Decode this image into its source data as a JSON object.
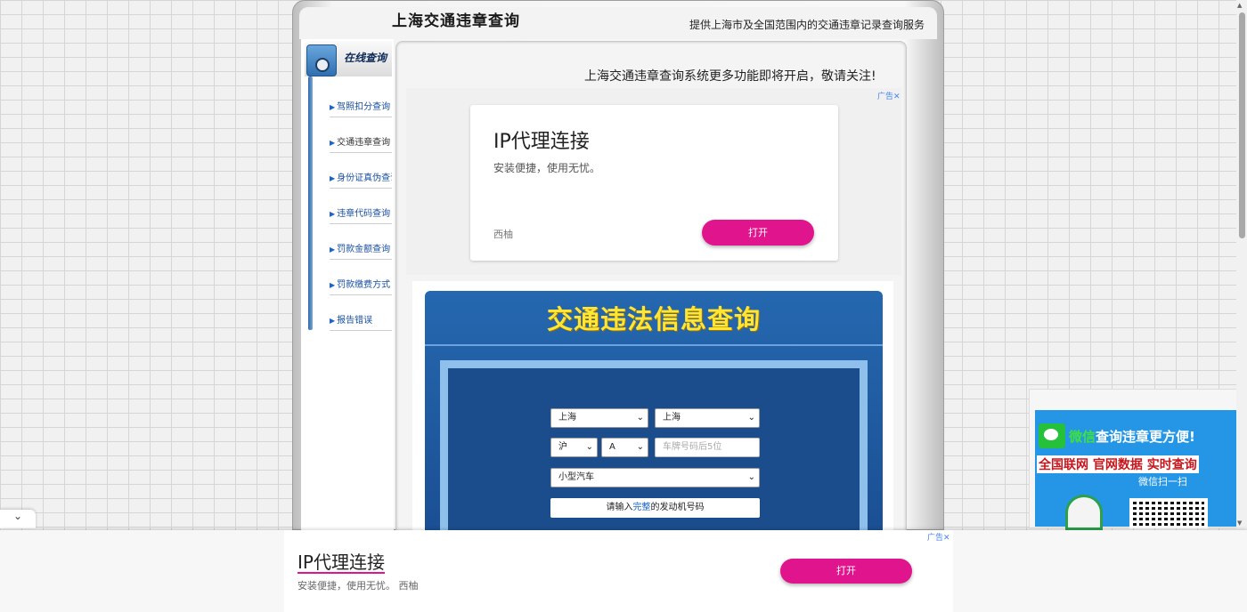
{
  "header": {
    "title": "上海交通违章查询",
    "slogan": "提供上海市及全国范围内的交通违章记录查询服务"
  },
  "menu": {
    "heading": "在线查询",
    "items": [
      {
        "label": "驾照扣分查询"
      },
      {
        "label": "交通违章查询"
      },
      {
        "label": "身份证真伪查询"
      },
      {
        "label": "违章代码查询"
      },
      {
        "label": "罚款金额查询"
      },
      {
        "label": "罚款缴费方式"
      },
      {
        "label": "报告错误"
      }
    ]
  },
  "notice": "上海交通违章查询系统更多功能即将开启，敬请关注!",
  "ad_top": {
    "mark": "广告",
    "close": "✕",
    "title": "IP代理连接",
    "subtitle": "安装便捷，使用无忧。",
    "brand": "西柚",
    "button": "打开"
  },
  "query": {
    "title": "交通违法信息查询",
    "province": "上海",
    "city": "上海",
    "plate_prefix": "沪",
    "plate_letter": "A",
    "plate_placeholder": "车牌号码后5位",
    "vehicle_type": "小型汽车",
    "engine_before": "请输入",
    "engine_highlight": "完整",
    "engine_after": "的发动机号码"
  },
  "wechat_promo": {
    "line1_green": "微信",
    "line1_white": "查询违章更方便!",
    "line2": "全国联网 官网数据 实时查询",
    "line3": "微信扫一扫"
  },
  "ad_bottom": {
    "mark": "广告",
    "close": "✕",
    "title": "IP代理连接",
    "subtitle": "安装便捷，使用无忧。 西柚",
    "button": "打开"
  },
  "colors": {
    "accent_pink": "#e0148c",
    "query_blue": "#1b4f93",
    "title_yellow": "#ffe635",
    "link_blue": "#1a50a0"
  }
}
